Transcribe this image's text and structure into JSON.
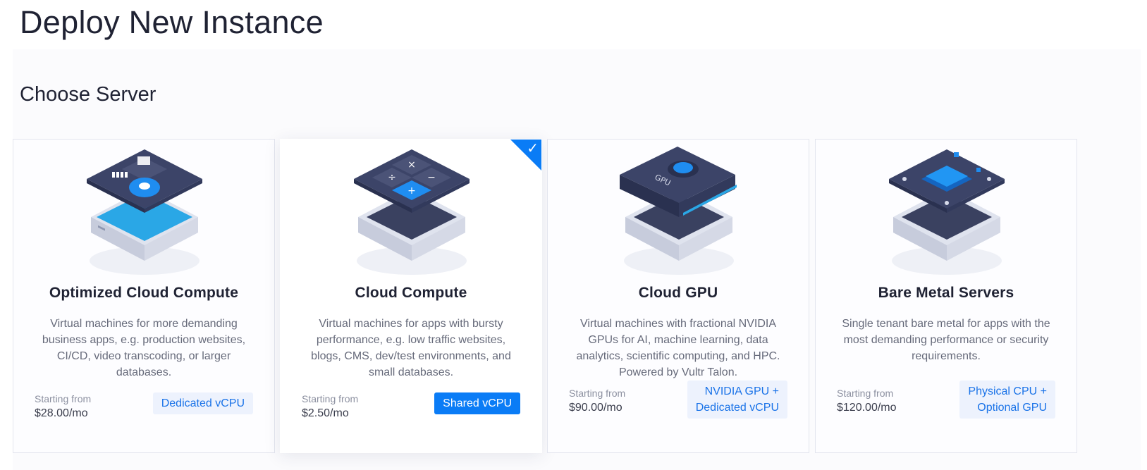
{
  "page": {
    "title": "Deploy New Instance"
  },
  "section": {
    "title": "Choose Server"
  },
  "cards": [
    {
      "title": "Optimized Cloud Compute",
      "description": "Virtual machines for more demanding business apps, e.g. production websites, CI/CD, video transcoding, or larger databases.",
      "starting_label": "Starting from",
      "price": "$28.00/mo",
      "tag_line1": "Dedicated vCPU",
      "tag_line2": "",
      "selected": false,
      "icon": "chip-cloud-server-icon"
    },
    {
      "title": "Cloud Compute",
      "description": "Virtual machines for apps with bursty performance, e.g. low traffic websites, blogs, CMS, dev/test environments, and small databases.",
      "starting_label": "Starting from",
      "price": "$2.50/mo",
      "tag_line1": "Shared vCPU",
      "tag_line2": "",
      "selected": true,
      "icon": "calculator-server-icon"
    },
    {
      "title": "Cloud GPU",
      "description": "Virtual machines with fractional NVIDIA GPUs for AI, machine learning, data analytics, scientific computing, and HPC. Powered by Vultr Talon.",
      "starting_label": "Starting from",
      "price": "$90.00/mo",
      "tag_line1": "NVIDIA GPU +",
      "tag_line2": "Dedicated vCPU",
      "selected": false,
      "icon": "gpu-card-server-icon"
    },
    {
      "title": "Bare Metal Servers",
      "description": "Single tenant bare metal for apps with the most demanding performance or security requirements.",
      "starting_label": "Starting from",
      "price": "$120.00/mo",
      "tag_line1": "Physical CPU +",
      "tag_line2": "Optional GPU",
      "selected": false,
      "icon": "cpu-board-server-icon"
    }
  ],
  "colors": {
    "accent": "#0a7cf6",
    "tag_bg": "#edf2fd",
    "tag_text": "#1a73e8",
    "board_dark": "#3c4468"
  },
  "check_icon": "checkmark-icon"
}
